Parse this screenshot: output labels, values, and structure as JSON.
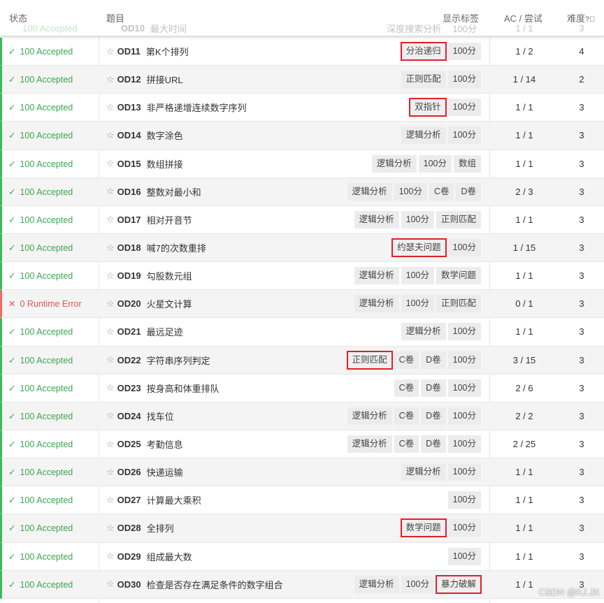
{
  "header": {
    "status": "状态",
    "title": "题目",
    "tags": "显示标签",
    "ac": "AC / 尝试",
    "difficulty": "难度"
  },
  "ghost_row": {
    "status": "100 Accepted",
    "code": "OD10",
    "name": "最大时间",
    "tags": [
      "深度搜索分析",
      "100分"
    ],
    "ac": "1 / 1",
    "difficulty": "3"
  },
  "rows": [
    {
      "status": "100 Accepted",
      "ok": true,
      "code": "OD11",
      "name": "第K个排列",
      "tags": [
        {
          "t": "分治递归",
          "hl": true
        },
        {
          "t": "100分"
        }
      ],
      "ac": "1 / 2",
      "difficulty": "4"
    },
    {
      "status": "100 Accepted",
      "ok": true,
      "code": "OD12",
      "name": "拼接URL",
      "tags": [
        {
          "t": "正则匹配"
        },
        {
          "t": "100分"
        }
      ],
      "ac": "1 / 14",
      "difficulty": "2"
    },
    {
      "status": "100 Accepted",
      "ok": true,
      "code": "OD13",
      "name": "非严格递增连续数字序列",
      "tags": [
        {
          "t": "双指针",
          "hl": true
        },
        {
          "t": "100分"
        }
      ],
      "ac": "1 / 1",
      "difficulty": "3"
    },
    {
      "status": "100 Accepted",
      "ok": true,
      "code": "OD14",
      "name": "数字涂色",
      "tags": [
        {
          "t": "逻辑分析"
        },
        {
          "t": "100分"
        }
      ],
      "ac": "1 / 1",
      "difficulty": "3"
    },
    {
      "status": "100 Accepted",
      "ok": true,
      "code": "OD15",
      "name": "数组拼接",
      "tags": [
        {
          "t": "逻辑分析"
        },
        {
          "t": "100分"
        },
        {
          "t": "数组"
        }
      ],
      "ac": "1 / 1",
      "difficulty": "3"
    },
    {
      "status": "100 Accepted",
      "ok": true,
      "code": "OD16",
      "name": "整数对最小和",
      "tags": [
        {
          "t": "逻辑分析"
        },
        {
          "t": "100分"
        },
        {
          "t": "C卷"
        },
        {
          "t": "D卷"
        }
      ],
      "ac": "2 / 3",
      "difficulty": "3"
    },
    {
      "status": "100 Accepted",
      "ok": true,
      "code": "OD17",
      "name": "相对开音节",
      "tags": [
        {
          "t": "逻辑分析"
        },
        {
          "t": "100分"
        },
        {
          "t": "正则匹配"
        }
      ],
      "ac": "1 / 1",
      "difficulty": "3"
    },
    {
      "status": "100 Accepted",
      "ok": true,
      "code": "OD18",
      "name": "喊7的次数重排",
      "tags": [
        {
          "t": "约瑟夫问题",
          "hl": true
        },
        {
          "t": "100分"
        }
      ],
      "ac": "1 / 15",
      "difficulty": "3"
    },
    {
      "status": "100 Accepted",
      "ok": true,
      "code": "OD19",
      "name": "勾股数元组",
      "tags": [
        {
          "t": "逻辑分析"
        },
        {
          "t": "100分"
        },
        {
          "t": "数学问题"
        }
      ],
      "ac": "1 / 1",
      "difficulty": "3"
    },
    {
      "status": "0 Runtime Error",
      "ok": false,
      "code": "OD20",
      "name": "火星文计算",
      "tags": [
        {
          "t": "逻辑分析"
        },
        {
          "t": "100分"
        },
        {
          "t": "正则匹配"
        }
      ],
      "ac": "0 / 1",
      "difficulty": "3"
    },
    {
      "status": "100 Accepted",
      "ok": true,
      "code": "OD21",
      "name": "最远足迹",
      "tags": [
        {
          "t": "逻辑分析"
        },
        {
          "t": "100分"
        }
      ],
      "ac": "1 / 1",
      "difficulty": "3"
    },
    {
      "status": "100 Accepted",
      "ok": true,
      "code": "OD22",
      "name": "字符串序列判定",
      "tags": [
        {
          "t": "正则匹配",
          "hl": true
        },
        {
          "t": "C卷"
        },
        {
          "t": "D卷"
        },
        {
          "t": "100分"
        }
      ],
      "ac": "3 / 15",
      "difficulty": "3"
    },
    {
      "status": "100 Accepted",
      "ok": true,
      "code": "OD23",
      "name": "按身高和体重排队",
      "tags": [
        {
          "t": "C卷"
        },
        {
          "t": "D卷"
        },
        {
          "t": "100分"
        }
      ],
      "ac": "2 / 6",
      "difficulty": "3"
    },
    {
      "status": "100 Accepted",
      "ok": true,
      "code": "OD24",
      "name": "找车位",
      "tags": [
        {
          "t": "逻辑分析"
        },
        {
          "t": "C卷"
        },
        {
          "t": "D卷"
        },
        {
          "t": "100分"
        }
      ],
      "ac": "2 / 2",
      "difficulty": "3"
    },
    {
      "status": "100 Accepted",
      "ok": true,
      "code": "OD25",
      "name": "考勤信息",
      "tags": [
        {
          "t": "逻辑分析"
        },
        {
          "t": "C卷"
        },
        {
          "t": "D卷"
        },
        {
          "t": "100分"
        }
      ],
      "ac": "2 / 25",
      "difficulty": "3"
    },
    {
      "status": "100 Accepted",
      "ok": true,
      "code": "OD26",
      "name": "快递运输",
      "tags": [
        {
          "t": "逻辑分析"
        },
        {
          "t": "100分"
        }
      ],
      "ac": "1 / 1",
      "difficulty": "3"
    },
    {
      "status": "100 Accepted",
      "ok": true,
      "code": "OD27",
      "name": "计算最大乘积",
      "tags": [
        {
          "t": "100分"
        }
      ],
      "ac": "1 / 1",
      "difficulty": "3"
    },
    {
      "status": "100 Accepted",
      "ok": true,
      "code": "OD28",
      "name": "全排列",
      "tags": [
        {
          "t": "数学问题",
          "hl": true
        },
        {
          "t": "100分"
        }
      ],
      "ac": "1 / 1",
      "difficulty": "3"
    },
    {
      "status": "100 Accepted",
      "ok": true,
      "code": "OD29",
      "name": "组成最大数",
      "tags": [
        {
          "t": "100分"
        }
      ],
      "ac": "1 / 1",
      "difficulty": "3"
    },
    {
      "status": "100 Accepted",
      "ok": true,
      "code": "OD30",
      "name": "检查是否存在满足条件的数字组合",
      "tags": [
        {
          "t": "逻辑分析"
        },
        {
          "t": "100分"
        },
        {
          "t": "暴力破解",
          "hl": true
        }
      ],
      "ac": "1 / 1",
      "difficulty": "3"
    }
  ],
  "watermark": "CSDN @KJ.JK",
  "colors": {
    "accepted": "#3aa74e",
    "error": "#e25555",
    "highlight": "#e0202a"
  }
}
